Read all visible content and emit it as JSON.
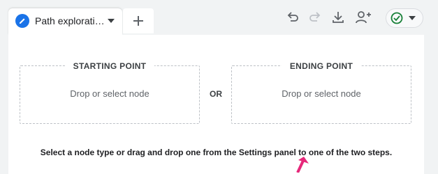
{
  "tab": {
    "label": "Path explorati…",
    "icon": "edit-pencil-icon",
    "accent": "#1a73e8"
  },
  "toolbar": {
    "add_tab_icon": "plus-icon",
    "undo_icon": "undo-icon",
    "redo_icon": "redo-icon",
    "download_icon": "download-icon",
    "share_icon": "person-add-icon",
    "status_icon": "check-circle-icon",
    "status_color": "#188038"
  },
  "panel": {
    "start": {
      "title": "STARTING POINT",
      "hint": "Drop or select node"
    },
    "separator": "OR",
    "end": {
      "title": "ENDING POINT",
      "hint": "Drop or select node"
    },
    "instruction": "Select a node type or drag and drop one from the Settings panel to one of the two steps."
  },
  "annotation": {
    "arrow_color": "#e6287a"
  }
}
